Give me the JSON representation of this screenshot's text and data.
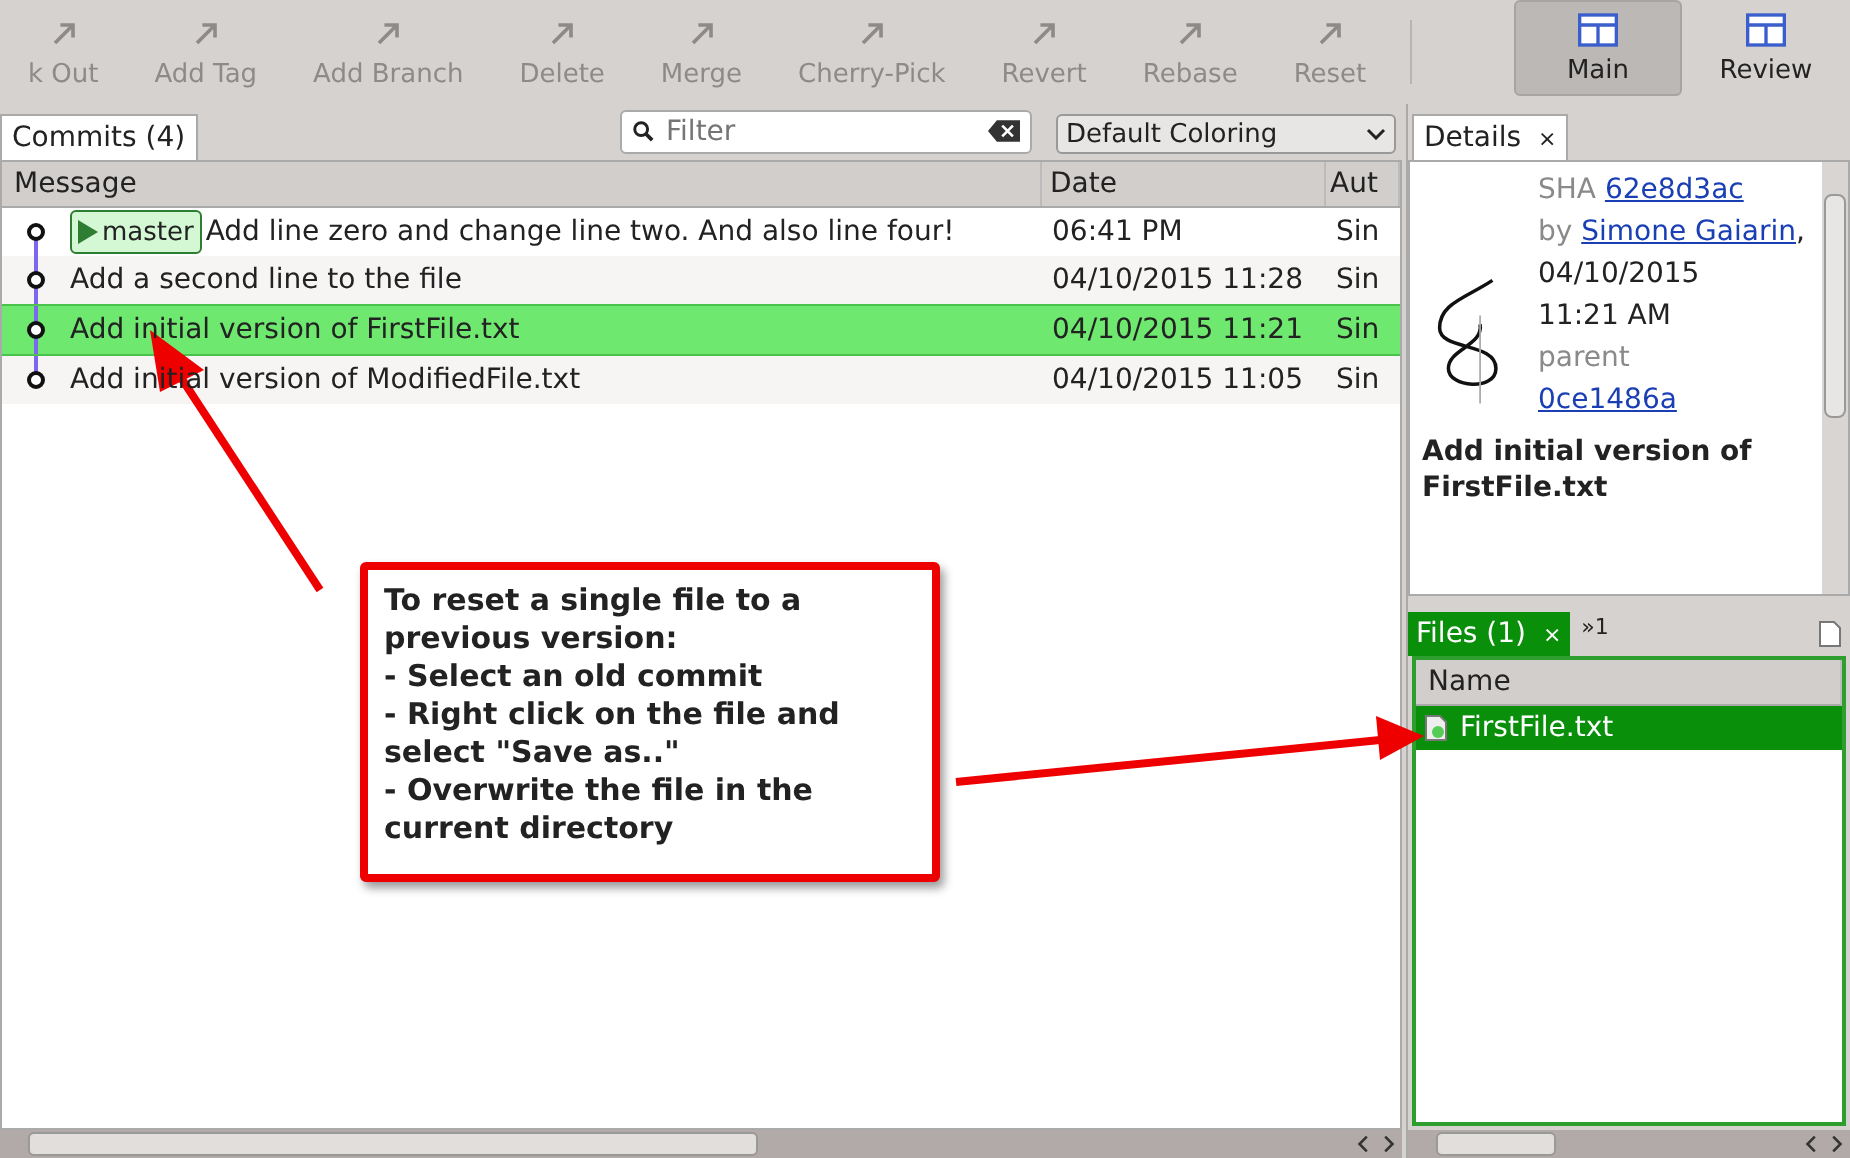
{
  "toolbar": {
    "actions": [
      {
        "label": "k Out",
        "disabled": true
      },
      {
        "label": "Add Tag",
        "disabled": true
      },
      {
        "label": "Add Branch",
        "disabled": true
      },
      {
        "label": "Delete",
        "disabled": true
      },
      {
        "label": "Merge",
        "disabled": true
      },
      {
        "label": "Cherry-Pick",
        "disabled": true
      },
      {
        "label": "Revert",
        "disabled": true
      },
      {
        "label": "Rebase",
        "disabled": true
      },
      {
        "label": "Reset",
        "disabled": true
      }
    ],
    "views": [
      {
        "label": "Main",
        "selected": true
      },
      {
        "label": "Review",
        "selected": false
      }
    ]
  },
  "commits_tab": {
    "label": "Commits (4)",
    "selected": true
  },
  "filter": {
    "placeholder": "Filter"
  },
  "coloring": {
    "value": "Default Coloring"
  },
  "table": {
    "columns": [
      "Message",
      "Date",
      "Aut"
    ],
    "rows": [
      {
        "branch": "master",
        "message": "Add line zero and change line two. And also line four!",
        "date": "06:41 PM",
        "author": "Sin",
        "selected": false
      },
      {
        "message": "Add a second line to the file",
        "date": "04/10/2015 11:28",
        "author": "Sin",
        "selected": false
      },
      {
        "message": "Add initial version of FirstFile.txt",
        "date": "04/10/2015 11:21",
        "author": "Sin",
        "selected": true
      },
      {
        "message": "Add initial version of ModifiedFile.txt",
        "date": "04/10/2015 11:05",
        "author": "Sin",
        "selected": false
      }
    ]
  },
  "details": {
    "tab": "Details",
    "close": "×",
    "sha_label": "SHA",
    "sha": "62e8d3ac",
    "by_label": "by",
    "author": "Simone Gaiarin",
    "comma": ",",
    "date": "04/10/2015",
    "time": "11:21 AM",
    "parent_label": "parent",
    "parent": "0ce1486a",
    "title": "Add initial version of FirstFile.txt"
  },
  "files": {
    "tab": {
      "label": "Files (1)",
      "selected": true
    },
    "close": "×",
    "more": "»1",
    "columns": [
      "Name"
    ],
    "rows": [
      {
        "name": "FirstFile.txt",
        "selected": true
      }
    ]
  },
  "callout": {
    "text": "To reset a single file to a\nprevious version:\n- Select an old commit\n- Right click on the file and\nselect \"Save as..\"\n- Overwrite the file in the\ncurrent directory"
  }
}
